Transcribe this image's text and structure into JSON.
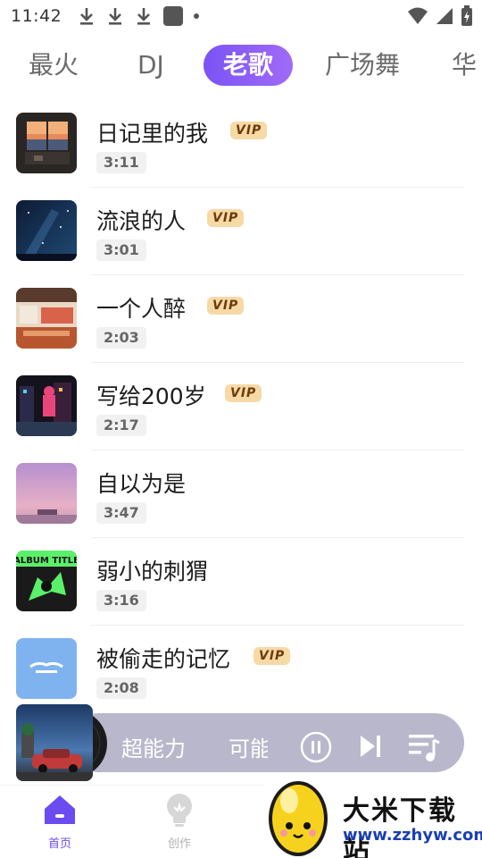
{
  "status_bar": {
    "time": "11:42",
    "left_icons": [
      "download-icon",
      "download-icon",
      "download-icon",
      "app-square-icon",
      "dot-icon"
    ],
    "right_icons": [
      "wifi-icon",
      "signal-icon",
      "battery-icon"
    ]
  },
  "tabs": [
    {
      "label": "最火",
      "active": false
    },
    {
      "label": "DJ",
      "active": false
    },
    {
      "label": "老歌",
      "active": true
    },
    {
      "label": "广场舞",
      "active": false
    },
    {
      "label": "华",
      "active": false
    }
  ],
  "songs": [
    {
      "title": "日记里的我",
      "vip": "VIP",
      "duration": "3:11",
      "cover": "sunset-window-cover"
    },
    {
      "title": "流浪的人",
      "vip": "VIP",
      "duration": "3:01",
      "cover": "starry-night-cover"
    },
    {
      "title": "一个人醉",
      "vip": "VIP",
      "duration": "2:03",
      "cover": "diner-interior-cover"
    },
    {
      "title": "写给200岁",
      "vip": "VIP",
      "duration": "2:17",
      "cover": "neon-city-cover"
    },
    {
      "title": "自以为是",
      "vip": "",
      "duration": "3:47",
      "cover": "purple-sky-car-cover"
    },
    {
      "title": "弱小的刺猬",
      "vip": "",
      "duration": "3:16",
      "cover": "album-title-green-cover"
    },
    {
      "title": "被偷走的记忆",
      "vip": "VIP",
      "duration": "2:08",
      "cover": "blue-logo-cover"
    }
  ],
  "cover_texts": {
    "album_title": "ALBUM TITLE"
  },
  "player": {
    "marquee_text": "超能力　　可能",
    "cover": "night-car-cover",
    "controls": [
      "pause-icon",
      "next-icon",
      "playlist-icon"
    ]
  },
  "bottom_nav": [
    {
      "label": "首页",
      "icon": "home-icon",
      "active": true
    },
    {
      "label": "创作",
      "icon": "lightbulb-icon",
      "active": false
    }
  ],
  "watermark": {
    "title": "大米下载站",
    "url": "www.zzhyw.com"
  },
  "colors": {
    "accent_gradient_start": "#7b54f5",
    "accent_gradient_end": "#a06af7",
    "vip_bg": "#f7d9a6",
    "vip_text": "#6b3b0d",
    "player_bar": "#b9b7cc"
  }
}
